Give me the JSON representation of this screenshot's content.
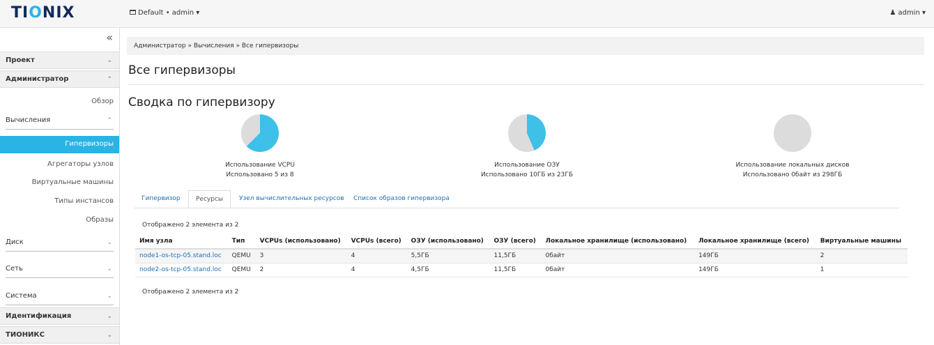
{
  "header": {
    "logo_prefix": "TI",
    "logo_o": "O",
    "logo_suffix": "NIX",
    "project_switch": "Default • admin ▾",
    "user_menu": "admin ▾"
  },
  "sidebar": {
    "collapse_glyph": "«",
    "sections": [
      {
        "label": "Проект"
      },
      {
        "label": "Администратор"
      }
    ],
    "overview": "Обзор",
    "compute_label": "Вычисления",
    "compute_items": [
      {
        "label": "Гипервизоры"
      },
      {
        "label": "Агрегаторы узлов"
      },
      {
        "label": "Виртуальные машины"
      },
      {
        "label": "Типы инстансов"
      },
      {
        "label": "Образы"
      }
    ],
    "subgroups": [
      {
        "label": "Диск"
      },
      {
        "label": "Сеть"
      },
      {
        "label": "Система"
      }
    ],
    "bottom_sections": [
      {
        "label": "Идентификация"
      },
      {
        "label": "ТИОНИКС"
      }
    ]
  },
  "breadcrumb": "Администратор » Вычисления » Все гипервизоры",
  "page_title": "Все гипервизоры",
  "summary": {
    "title": "Сводка по гипервизору",
    "charts": [
      {
        "title": "Использование VCPU",
        "subtitle": "Использовано 5 из 8",
        "used": 5,
        "total": 8
      },
      {
        "title": "Использование ОЗУ",
        "subtitle": "Использовано 10ГБ из 23ГБ",
        "used": 10,
        "total": 23
      },
      {
        "title": "Использование локальных дисков",
        "subtitle": "Использовано 0байт из 298ГБ",
        "used": 0,
        "total": 298
      }
    ]
  },
  "colors": {
    "used": "#3ec0e8",
    "free": "#dcdcdc",
    "accent": "#2ab4e6"
  },
  "tabs": [
    {
      "label": "Гипервизор"
    },
    {
      "label": "Ресурсы"
    },
    {
      "label": "Узел вычислительных ресурсов"
    },
    {
      "label": "Список образов гипервизора"
    }
  ],
  "table": {
    "count_label": "Отображено 2 элемента из 2",
    "columns": [
      "Имя узла",
      "Тип",
      "VCPUs (использовано)",
      "VCPUs (всего)",
      "ОЗУ (использовано)",
      "ОЗУ (всего)",
      "Локальное хранилище (использовано)",
      "Локальное хранилище (всего)",
      "Виртуальные машины"
    ],
    "rows": [
      [
        "node1-os-tcp-05.stand.loc",
        "QEMU",
        "3",
        "4",
        "5,5ГБ",
        "11,5ГБ",
        "0байт",
        "149ГБ",
        "2"
      ],
      [
        "node2-os-tcp-05.stand.loc",
        "QEMU",
        "2",
        "4",
        "4,5ГБ",
        "11,5ГБ",
        "0байт",
        "149ГБ",
        "1"
      ]
    ]
  }
}
